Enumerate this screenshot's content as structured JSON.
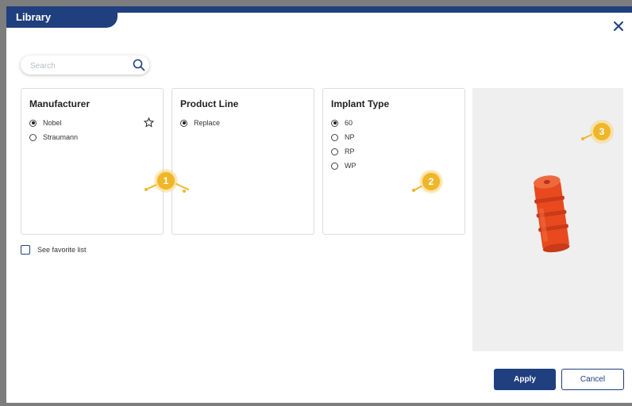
{
  "dialog": {
    "title": "Library"
  },
  "search": {
    "placeholder": "Search"
  },
  "panels": {
    "manufacturer": {
      "title": "Manufacturer",
      "options": [
        {
          "label": "Nobel",
          "selected": true
        },
        {
          "label": "Straumann",
          "selected": false
        }
      ]
    },
    "product_line": {
      "title": "Product Line",
      "options": [
        {
          "label": "Replace",
          "selected": true
        }
      ]
    },
    "implant_type": {
      "title": "Implant Type",
      "options": [
        {
          "label": "60",
          "selected": true
        },
        {
          "label": "NP",
          "selected": false
        },
        {
          "label": "RP",
          "selected": false
        },
        {
          "label": "WP",
          "selected": false
        }
      ]
    }
  },
  "markers": {
    "m1": "1",
    "m2": "2",
    "m3": "3"
  },
  "favorite": {
    "label": "See favorite list",
    "checked": false
  },
  "buttons": {
    "apply": "Apply",
    "cancel": "Cancel"
  },
  "colors": {
    "primary": "#1f3f7e",
    "marker": "#f0b62a",
    "model": "#e8491f"
  },
  "icons": {
    "close": "close-icon",
    "search": "search-icon",
    "favorite": "star-icon",
    "model": "implant-3d-model"
  }
}
